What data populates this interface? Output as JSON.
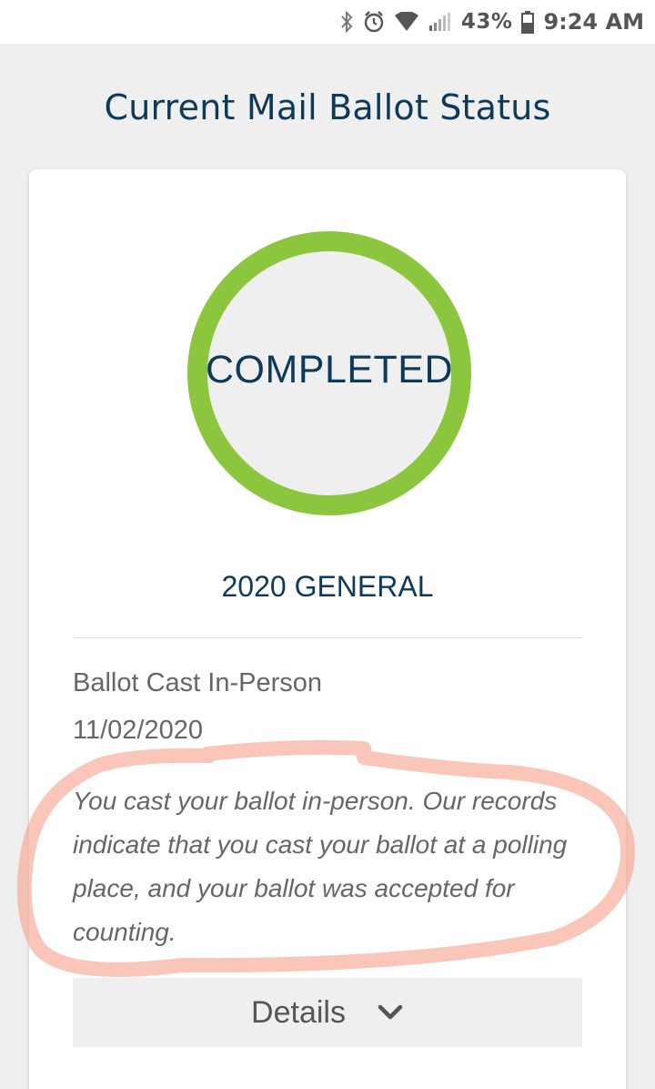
{
  "status_bar": {
    "battery": "43%",
    "time": "9:24 AM",
    "icons": [
      "bluetooth-icon",
      "alarm-icon",
      "wifi-icon",
      "signal-icon",
      "battery-icon"
    ]
  },
  "page": {
    "title": "Current Mail Ballot Status"
  },
  "ballot": {
    "status": "COMPLETED",
    "status_color": "#8cc63f",
    "election": "2020 GENERAL",
    "label": "Ballot Cast In-Person",
    "date": "11/02/2020",
    "description": "You cast your ballot in-person. Our records indicate that you cast your ballot at a polling place, and your ballot was accepted for counting.",
    "details_label": "Details",
    "details_icon": "chevron-down-icon"
  },
  "annotation": {
    "highlight_color": "#f7a08a"
  },
  "colors": {
    "primary_text": "#0e3a5a",
    "body_text": "#666666",
    "background": "#efefef"
  }
}
